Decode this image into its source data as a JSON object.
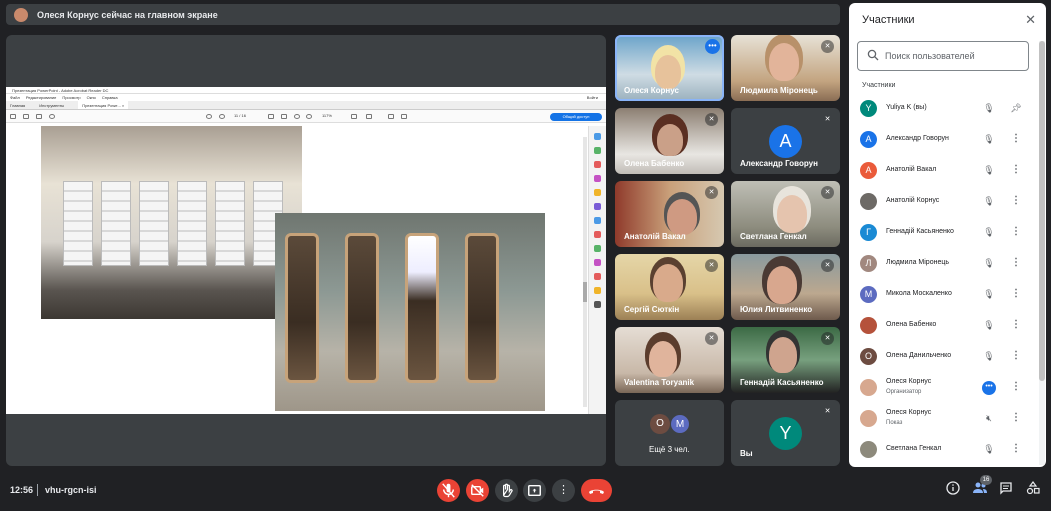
{
  "banner": {
    "text": "Олеся Корнус сейчас на главном экране"
  },
  "acrobat": {
    "title": "Презентация PowerPoint - Adobe Acrobat Reader DC",
    "menu": [
      "Файл",
      "Редактирование",
      "Просмотр",
      "Окно",
      "Справка"
    ],
    "tabs": [
      "Главная",
      "Инструменты",
      "Презентация Powe... ×"
    ],
    "page_indicator": "11 / 16",
    "zoom": "117%",
    "share_label": "Общий доступ",
    "signin": "Войти"
  },
  "tiles": [
    {
      "name": "Олеся Корнус",
      "type": "video",
      "active": true,
      "icon": "more-dots-icon"
    },
    {
      "name": "Людмила Міронець",
      "type": "video",
      "icon": "mic-off-icon"
    },
    {
      "name": "Олена Бабенко",
      "type": "video",
      "icon": "mic-off-icon"
    },
    {
      "name": "Александр Говорун",
      "type": "avatar",
      "initial": "А",
      "color": "#1a73e8",
      "icon": "mic-off-icon"
    },
    {
      "name": "Анатолій Вакал",
      "type": "video",
      "icon": "mic-off-icon"
    },
    {
      "name": "Светлана Генкал",
      "type": "video",
      "icon": "mic-off-icon"
    },
    {
      "name": "Сергій Сюткін",
      "type": "video",
      "icon": "mic-off-icon"
    },
    {
      "name": "Юлия Литвиненко",
      "type": "video",
      "icon": "mic-off-icon"
    },
    {
      "name": "Valentina Toryanik",
      "type": "video",
      "icon": "mic-off-icon"
    },
    {
      "name": "Геннадій Касьяненко",
      "type": "video",
      "icon": "mic-off-icon"
    },
    {
      "name": "Ещё 3 чел.",
      "type": "more",
      "initials": [
        "О",
        "М"
      ]
    },
    {
      "name": "Вы",
      "type": "avatar",
      "initial": "Y",
      "color": "#00897b",
      "icon": "mic-off-icon"
    }
  ],
  "bottom": {
    "time": "12:56",
    "meeting_code": "vhu-rgcn-isi",
    "participants_count": "16"
  },
  "panel": {
    "title": "Участники",
    "search_placeholder": "Поиск пользователей",
    "section": "Участники",
    "people": [
      {
        "name": "Yuliya K (вы)",
        "initial": "Y",
        "color": "#00897b",
        "action": "pin"
      },
      {
        "name": "Александр Говорун",
        "initial": "А",
        "color": "#1a73e8",
        "action": "more"
      },
      {
        "name": "Анатолій Вакал",
        "initial": "А",
        "color": "#ea5b3a",
        "action": "more"
      },
      {
        "name": "Анатолій Корнус",
        "initial": "",
        "color": "#6d6a66",
        "action": "more"
      },
      {
        "name": "Геннадій Касьяненко",
        "initial": "Г",
        "color": "#1a8ad4",
        "action": "more"
      },
      {
        "name": "Людмила Міронець",
        "initial": "Л",
        "color": "#a1887f",
        "action": "more"
      },
      {
        "name": "Микола Москаленко",
        "initial": "М",
        "color": "#5c6bc0",
        "action": "more"
      },
      {
        "name": "Олена Бабенко",
        "initial": "",
        "color": "#b5523b",
        "action": "more"
      },
      {
        "name": "Олена Данильченко",
        "initial": "О",
        "color": "#6d4c41",
        "action": "more"
      },
      {
        "name": "Олеся Корнус",
        "role": "Организатор",
        "initial": "",
        "color": "#d7a88f",
        "action": "more",
        "speaking": true
      },
      {
        "name": "Олеся Корнус",
        "role": "Показ",
        "initial": "",
        "color": "#d7a88f",
        "action": "more",
        "presenting": true
      },
      {
        "name": "Светлана Генкал",
        "initial": "",
        "color": "#8d8a7c",
        "action": "more"
      }
    ]
  }
}
